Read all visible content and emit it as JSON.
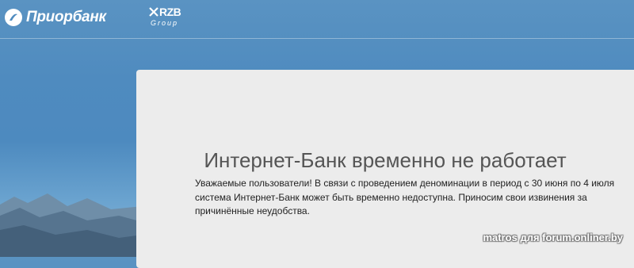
{
  "header": {
    "bank_name": "Приорбанк",
    "partner_logo": "RZB",
    "partner_group": "Group"
  },
  "notice": {
    "title": "Интернет-Банк временно не работает",
    "message": "Уважаемые пользователи! В связи с проведением деноминации в период с 30 июня по 4 июля система Интернет-Банк может быть временно недоступна. Приносим свои извинения за причинённые неудобства."
  },
  "watermark": "matros для forum.onliner.by",
  "icons": {
    "bank_logo": "priorbank-emblem-icon",
    "partner_logo": "rzb-logo-icon"
  }
}
